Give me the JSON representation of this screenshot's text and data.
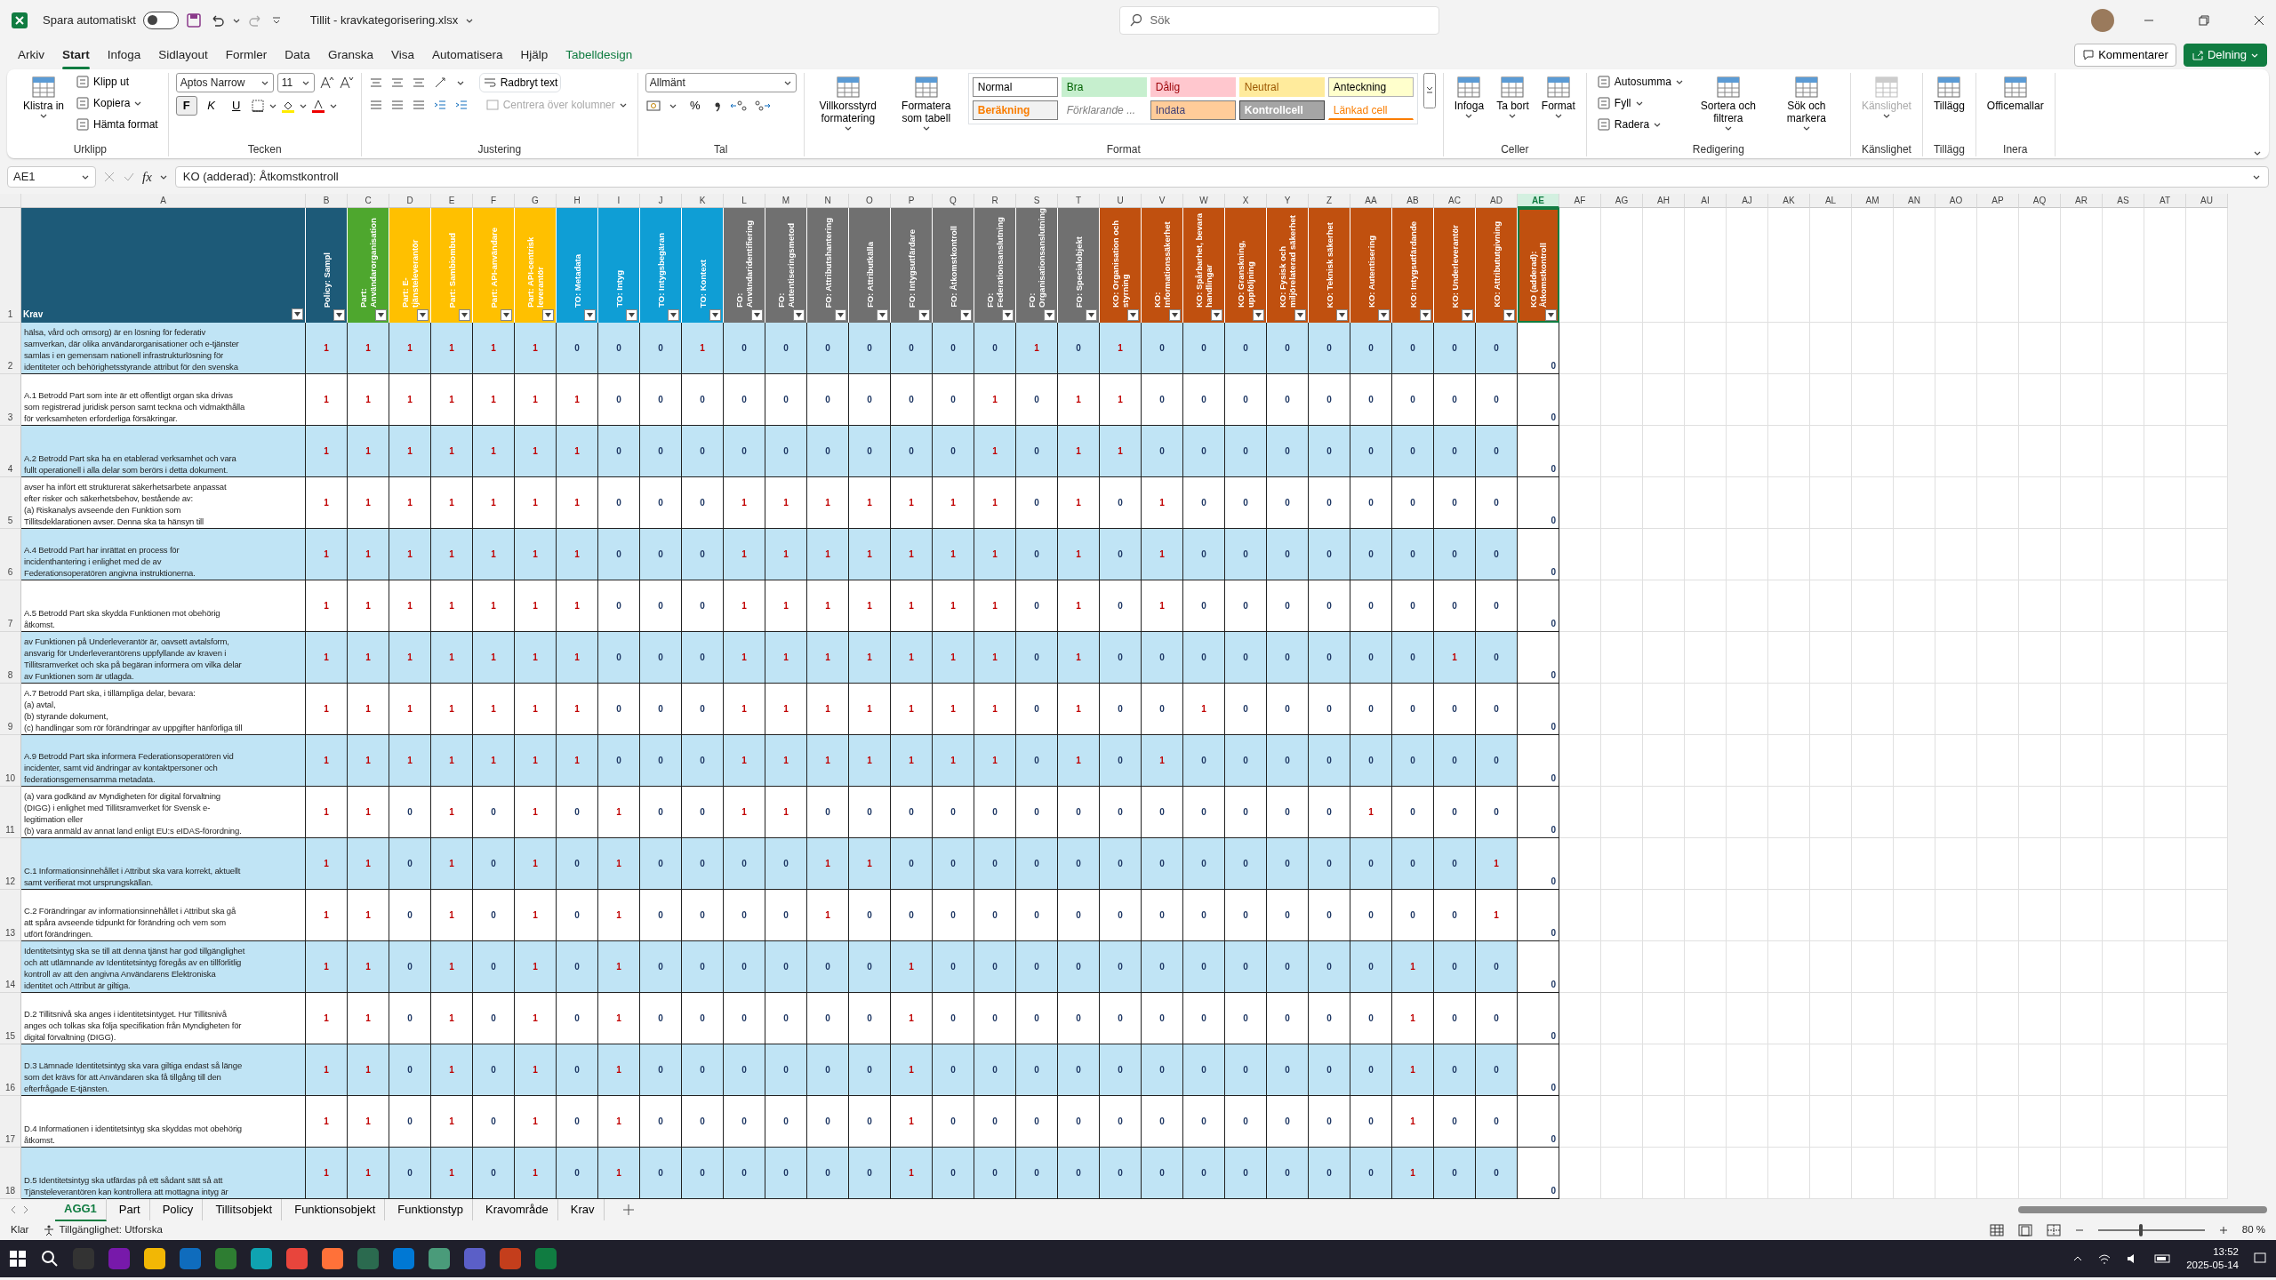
{
  "titlebar": {
    "autosave_label": "Spara automatiskt",
    "autosave_on": false,
    "file_title": "Tillit - kravkategorisering.xlsx",
    "search_placeholder": "Sök"
  },
  "menu_tabs": [
    {
      "label": "Arkiv",
      "selected": false,
      "kind": "standard"
    },
    {
      "label": "Start",
      "selected": true,
      "kind": "standard"
    },
    {
      "label": "Infoga",
      "selected": false,
      "kind": "standard"
    },
    {
      "label": "Sidlayout",
      "selected": false,
      "kind": "standard"
    },
    {
      "label": "Formler",
      "selected": false,
      "kind": "standard"
    },
    {
      "label": "Data",
      "selected": false,
      "kind": "standard"
    },
    {
      "label": "Granska",
      "selected": false,
      "kind": "standard"
    },
    {
      "label": "Visa",
      "selected": false,
      "kind": "standard"
    },
    {
      "label": "Automatisera",
      "selected": false,
      "kind": "standard"
    },
    {
      "label": "Hjälp",
      "selected": false,
      "kind": "standard"
    },
    {
      "label": "Tabelldesign",
      "selected": false,
      "kind": "contextual"
    }
  ],
  "actions": {
    "comments": "Kommentarer",
    "share": "Delning"
  },
  "ribbon": [
    {
      "kind": "clipboard",
      "group": "Urklipp",
      "large": [
        {
          "label": "Klistra in",
          "has_menu": true,
          "disabled": false
        }
      ],
      "small": [
        {
          "label": "Klipp ut",
          "has_menu": false
        },
        {
          "label": "Kopiera",
          "has_menu": true
        },
        {
          "label": "Hämta format",
          "has_menu": false
        }
      ]
    },
    {
      "kind": "font",
      "group": "Tecken",
      "font": "Aptos Narrow",
      "size": "11",
      "style_buttons": [
        {
          "label": "F",
          "selected": true
        },
        {
          "label": "K",
          "selected": false
        },
        {
          "label": "U",
          "selected": false
        }
      ]
    },
    {
      "kind": "align",
      "group": "Justering",
      "wrap": "Radbryt text",
      "merge": "Centrera över kolumner",
      "merge_disabled": true
    },
    {
      "kind": "number",
      "group": "Tal",
      "format": "Allmänt",
      "percent": "%"
    },
    {
      "kind": "styles",
      "group": "Format",
      "large": [
        {
          "label": "Villkorsstyrd formatering",
          "has_menu": true,
          "disabled": false
        },
        {
          "label": "Formatera som tabell",
          "has_menu": true,
          "disabled": false
        }
      ],
      "styles": [
        {
          "label": "Normal",
          "kind": "normal"
        },
        {
          "label": "Bra",
          "kind": "good"
        },
        {
          "label": "Dålig",
          "kind": "bad"
        },
        {
          "label": "Neutral",
          "kind": "neutral"
        },
        {
          "label": "Anteckning",
          "kind": "note"
        },
        {
          "label": "Beräkning",
          "kind": "calc"
        },
        {
          "label": "Förklarande ...",
          "kind": "explanatory"
        },
        {
          "label": "Indata",
          "kind": "input"
        },
        {
          "label": "Kontrollcell",
          "kind": "check"
        },
        {
          "label": "Länkad cell",
          "kind": "linked"
        }
      ]
    },
    {
      "kind": "buttons",
      "group": "Celler",
      "large": [
        {
          "label": "Infoga",
          "has_menu": true,
          "disabled": false
        },
        {
          "label": "Ta bort",
          "has_menu": true,
          "disabled": false
        },
        {
          "label": "Format",
          "has_menu": true,
          "disabled": false
        }
      ]
    },
    {
      "kind": "buttons",
      "group": "Redigering",
      "small": [
        {
          "label": "Autosumma",
          "has_menu": true
        },
        {
          "label": "Fyll",
          "has_menu": true
        },
        {
          "label": "Radera",
          "has_menu": true
        }
      ],
      "large": [
        {
          "label": "Sortera och filtrera",
          "has_menu": true,
          "disabled": false
        },
        {
          "label": "Sök och markera",
          "has_menu": true,
          "disabled": false
        }
      ]
    },
    {
      "kind": "buttons",
      "group": "Känslighet",
      "large": [
        {
          "label": "Känslighet",
          "has_menu": true,
          "disabled": true
        }
      ]
    },
    {
      "kind": "buttons",
      "group": "Tillägg",
      "large": [
        {
          "label": "Tillägg",
          "has_menu": false,
          "disabled": false
        }
      ]
    },
    {
      "kind": "buttons",
      "group": "Inera",
      "large": [
        {
          "label": "Officemallar",
          "has_menu": false,
          "disabled": false
        }
      ]
    }
  ],
  "formula_bar": {
    "name_box": "AE1",
    "fx": "fx",
    "formula": "KO (adderad): Åtkomstkontroll"
  },
  "column_letters": [
    {
      "label": "A",
      "selected": false
    },
    {
      "label": "B",
      "selected": false
    },
    {
      "label": "C",
      "selected": false
    },
    {
      "label": "D",
      "selected": false
    },
    {
      "label": "E",
      "selected": false
    },
    {
      "label": "F",
      "selected": false
    },
    {
      "label": "G",
      "selected": false
    },
    {
      "label": "H",
      "selected": false
    },
    {
      "label": "I",
      "selected": false
    },
    {
      "label": "J",
      "selected": false
    },
    {
      "label": "K",
      "selected": false
    },
    {
      "label": "L",
      "selected": false
    },
    {
      "label": "M",
      "selected": false
    },
    {
      "label": "N",
      "selected": false
    },
    {
      "label": "O",
      "selected": false
    },
    {
      "label": "P",
      "selected": false
    },
    {
      "label": "Q",
      "selected": false
    },
    {
      "label": "R",
      "selected": false
    },
    {
      "label": "S",
      "selected": false
    },
    {
      "label": "T",
      "selected": false
    },
    {
      "label": "U",
      "selected": false
    },
    {
      "label": "V",
      "selected": false
    },
    {
      "label": "W",
      "selected": false
    },
    {
      "label": "X",
      "selected": false
    },
    {
      "label": "Y",
      "selected": false
    },
    {
      "label": "Z",
      "selected": false
    },
    {
      "label": "AA",
      "selected": false
    },
    {
      "label": "AB",
      "selected": false
    },
    {
      "label": "AC",
      "selected": false
    },
    {
      "label": "AD",
      "selected": false
    },
    {
      "label": "AE",
      "selected": true
    },
    {
      "label": "AF",
      "selected": false
    },
    {
      "label": "AG",
      "selected": false
    },
    {
      "label": "AH",
      "selected": false
    },
    {
      "label": "AI",
      "selected": false
    },
    {
      "label": "AJ",
      "selected": false
    },
    {
      "label": "AK",
      "selected": false
    },
    {
      "label": "AL",
      "selected": false
    },
    {
      "label": "AM",
      "selected": false
    },
    {
      "label": "AN",
      "selected": false
    },
    {
      "label": "AO",
      "selected": false
    },
    {
      "label": "AP",
      "selected": false
    },
    {
      "label": "AQ",
      "selected": false
    },
    {
      "label": "AR",
      "selected": false
    },
    {
      "label": "AS",
      "selected": false
    },
    {
      "label": "AT",
      "selected": false
    },
    {
      "label": "AU",
      "selected": false
    }
  ],
  "header_row": {
    "row": "1",
    "first": "Krav",
    "labels": [
      {
        "text": "Policy: Sampl",
        "color": "#1d5a78"
      },
      {
        "text": "Part: Användarorganisation",
        "color": "#4ea72e"
      },
      {
        "text": "Part: E-tjänsteleverantör",
        "color": "#ffc000"
      },
      {
        "text": "Part: Sambiombud",
        "color": "#ffc000"
      },
      {
        "text": "Part: API-användare",
        "color": "#ffc000"
      },
      {
        "text": "Part: API-centrisk leverantör",
        "color": "#ffc000"
      },
      {
        "text": "TO: Metadata",
        "color": "#0f9ed5"
      },
      {
        "text": "TO: Intyg",
        "color": "#0f9ed5"
      },
      {
        "text": "TO: Intygsbegäran",
        "color": "#0f9ed5"
      },
      {
        "text": "TO: Kontext",
        "color": "#0f9ed5"
      },
      {
        "text": "FO: Användaridentifiering",
        "color": "#707070"
      },
      {
        "text": "FO: Autentiseringsmetod",
        "color": "#707070"
      },
      {
        "text": "FO: Attributshantering",
        "color": "#707070"
      },
      {
        "text": "FO: Attributkälla",
        "color": "#707070"
      },
      {
        "text": "FO: Intygsutfärdare",
        "color": "#707070"
      },
      {
        "text": "FO: Åtkomstkontroll",
        "color": "#707070"
      },
      {
        "text": "FO: Federationsanslutning",
        "color": "#707070"
      },
      {
        "text": "FO: Organisationsanslutning",
        "color": "#707070"
      },
      {
        "text": "FO: Specialobjekt",
        "color": "#707070"
      },
      {
        "text": "KO: Organisation och styrning",
        "color": "#c0500f"
      },
      {
        "text": "KO: Informationssäkerhet",
        "color": "#c0500f"
      },
      {
        "text": "KO: Spårbarhet, bevara handlingar",
        "color": "#c0500f"
      },
      {
        "text": "KO: Granskning, uppföljning",
        "color": "#c0500f"
      },
      {
        "text": "KO: Fysisk och miljörelaterad säkerhet",
        "color": "#c0500f"
      },
      {
        "text": "KO: Teknisk säkerhet",
        "color": "#c0500f"
      },
      {
        "text": "KO: Autentisering",
        "color": "#c0500f"
      },
      {
        "text": "KO: Intygsutfärdande",
        "color": "#c0500f"
      },
      {
        "text": "KO: Underleverantör",
        "color": "#c0500f"
      },
      {
        "text": "KO: Attribututgivning",
        "color": "#c0500f"
      },
      {
        "text": "KO (adderad): Åtkomstkontroll",
        "color": "#c0500f"
      }
    ]
  },
  "rows": [
    {
      "row": "2",
      "krav": [
        "hälsa, vård och omsorg) är en lösning för federativ",
        "samverkan, där olika användarorganisationer och e-tjänster",
        "samlas i en gemensam nationell infrastrukturlösning för",
        "identiteter och behörighetsstyrande attribut för den svenska"
      ],
      "values": [
        "1",
        "1",
        "1",
        "1",
        "1",
        "1",
        "0",
        "0",
        "0",
        "1",
        "0",
        "0",
        "0",
        "0",
        "0",
        "0",
        "0",
        "1",
        "0",
        "1",
        "0",
        "0",
        "0",
        "0",
        "0",
        "0",
        "0",
        "0",
        "0",
        "0"
      ]
    },
    {
      "row": "3",
      "krav": [
        "A.1 Betrodd Part som inte är ett offentligt organ ska drivas",
        "som registrerad juridisk person samt teckna och vidmakthålla",
        "för verksamheten erforderliga försäkringar."
      ],
      "values": [
        "1",
        "1",
        "1",
        "1",
        "1",
        "1",
        "1",
        "0",
        "0",
        "0",
        "0",
        "0",
        "0",
        "0",
        "0",
        "0",
        "1",
        "0",
        "1",
        "1",
        "0",
        "0",
        "0",
        "0",
        "0",
        "0",
        "0",
        "0",
        "0",
        "0"
      ]
    },
    {
      "row": "4",
      "krav": [
        "A.2 Betrodd Part ska ha en etablerad verksamhet och vara",
        "fullt operationell i alla delar som berörs i detta dokument."
      ],
      "values": [
        "1",
        "1",
        "1",
        "1",
        "1",
        "1",
        "1",
        "0",
        "0",
        "0",
        "0",
        "0",
        "0",
        "0",
        "0",
        "0",
        "1",
        "0",
        "1",
        "1",
        "0",
        "0",
        "0",
        "0",
        "0",
        "0",
        "0",
        "0",
        "0",
        "0"
      ]
    },
    {
      "row": "5",
      "krav": [
        "avser ha infört ett strukturerat säkerhetsarbete anpassat",
        "efter risker och säkerhetsbehov, bestående av:",
        "(a) Riskanalys avseende den Funktion som",
        "Tillitsdeklarationen avser. Denna ska ta hänsyn till"
      ],
      "values": [
        "1",
        "1",
        "1",
        "1",
        "1",
        "1",
        "1",
        "0",
        "0",
        "0",
        "1",
        "1",
        "1",
        "1",
        "1",
        "1",
        "1",
        "0",
        "1",
        "0",
        "1",
        "0",
        "0",
        "0",
        "0",
        "0",
        "0",
        "0",
        "0",
        "0"
      ]
    },
    {
      "row": "6",
      "krav": [
        "A.4 Betrodd Part har inrättat en process för",
        "incidenthantering i enlighet med de av",
        "Federationsoperatören angivna instruktionerna."
      ],
      "values": [
        "1",
        "1",
        "1",
        "1",
        "1",
        "1",
        "1",
        "0",
        "0",
        "0",
        "1",
        "1",
        "1",
        "1",
        "1",
        "1",
        "1",
        "0",
        "1",
        "0",
        "1",
        "0",
        "0",
        "0",
        "0",
        "0",
        "0",
        "0",
        "0",
        "0"
      ]
    },
    {
      "row": "7",
      "krav": [
        "A.5 Betrodd Part ska skydda Funktionen mot obehörig",
        "åtkomst."
      ],
      "values": [
        "1",
        "1",
        "1",
        "1",
        "1",
        "1",
        "1",
        "0",
        "0",
        "0",
        "1",
        "1",
        "1",
        "1",
        "1",
        "1",
        "1",
        "0",
        "1",
        "0",
        "1",
        "0",
        "0",
        "0",
        "0",
        "0",
        "0",
        "0",
        "0",
        "0"
      ]
    },
    {
      "row": "8",
      "krav": [
        "av Funktionen på Underleverantör är, oavsett avtalsform,",
        "ansvarig för Underleverantörens uppfyllande av kraven i",
        "Tillitsramverket och ska på begäran informera om vilka delar",
        "av Funktionen som är utlagda."
      ],
      "values": [
        "1",
        "1",
        "1",
        "1",
        "1",
        "1",
        "1",
        "0",
        "0",
        "0",
        "1",
        "1",
        "1",
        "1",
        "1",
        "1",
        "1",
        "0",
        "1",
        "0",
        "0",
        "0",
        "0",
        "0",
        "0",
        "0",
        "0",
        "1",
        "0",
        "0"
      ]
    },
    {
      "row": "9",
      "krav": [
        "A.7 Betrodd Part ska, i tillämpliga delar, bevara:",
        "(a) avtal,",
        "(b) styrande dokument,",
        "(c) handlingar som rör förändringar av uppgifter hänförliga till"
      ],
      "values": [
        "1",
        "1",
        "1",
        "1",
        "1",
        "1",
        "1",
        "0",
        "0",
        "0",
        "1",
        "1",
        "1",
        "1",
        "1",
        "1",
        "1",
        "0",
        "1",
        "0",
        "0",
        "1",
        "0",
        "0",
        "0",
        "0",
        "0",
        "0",
        "0",
        "0"
      ]
    },
    {
      "row": "10",
      "krav": [
        "A.9 Betrodd Part ska informera Federationsoperatören vid",
        "incidenter, samt vid ändringar av kontaktpersoner och",
        "federationsgemensamma metadata."
      ],
      "values": [
        "1",
        "1",
        "1",
        "1",
        "1",
        "1",
        "1",
        "0",
        "0",
        "0",
        "1",
        "1",
        "1",
        "1",
        "1",
        "1",
        "1",
        "0",
        "1",
        "0",
        "1",
        "0",
        "0",
        "0",
        "0",
        "0",
        "0",
        "0",
        "0",
        "0"
      ]
    },
    {
      "row": "11",
      "krav": [
        "(a) vara godkänd av Myndigheten för digital förvaltning",
        "(DIGG) i enlighet med Tillitsramverket för Svensk e-",
        "legitimation eller",
        "(b) vara anmäld av annat land enligt EU:s eIDAS-förordning."
      ],
      "values": [
        "1",
        "1",
        "0",
        "1",
        "0",
        "1",
        "0",
        "1",
        "0",
        "0",
        "1",
        "1",
        "0",
        "0",
        "0",
        "0",
        "0",
        "0",
        "0",
        "0",
        "0",
        "0",
        "0",
        "0",
        "0",
        "1",
        "0",
        "0",
        "0",
        "0"
      ]
    },
    {
      "row": "12",
      "krav": [
        "C.1 Informationsinnehållet i Attribut ska vara korrekt, aktuellt",
        "samt verifierat mot ursprungskällan."
      ],
      "values": [
        "1",
        "1",
        "0",
        "1",
        "0",
        "1",
        "0",
        "1",
        "0",
        "0",
        "0",
        "0",
        "1",
        "1",
        "0",
        "0",
        "0",
        "0",
        "0",
        "0",
        "0",
        "0",
        "0",
        "0",
        "0",
        "0",
        "0",
        "0",
        "1",
        "0"
      ]
    },
    {
      "row": "13",
      "krav": [
        "C.2 Förändringar av informationsinnehållet i Attribut ska gå",
        "att spåra avseende tidpunkt för förändring och vem som",
        "utfört förändringen."
      ],
      "values": [
        "1",
        "1",
        "0",
        "1",
        "0",
        "1",
        "0",
        "1",
        "0",
        "0",
        "0",
        "0",
        "1",
        "0",
        "0",
        "0",
        "0",
        "0",
        "0",
        "0",
        "0",
        "0",
        "0",
        "0",
        "0",
        "0",
        "0",
        "0",
        "1",
        "0"
      ]
    },
    {
      "row": "14",
      "krav": [
        "Identitetsintyg ska se till att denna tjänst har god tillgänglighet",
        "och att utlämnande av Identitetsintyg föregås av en tillförlitlig",
        "kontroll av att den angivna Användarens Elektroniska",
        "identitet och Attribut är giltiga."
      ],
      "values": [
        "1",
        "1",
        "0",
        "1",
        "0",
        "1",
        "0",
        "1",
        "0",
        "0",
        "0",
        "0",
        "0",
        "0",
        "1",
        "0",
        "0",
        "0",
        "0",
        "0",
        "0",
        "0",
        "0",
        "0",
        "0",
        "0",
        "1",
        "0",
        "0",
        "0"
      ]
    },
    {
      "row": "15",
      "krav": [
        "D.2 Tillitsnivå ska anges i identitetsintyget. Hur Tillitsnivå",
        "anges och tolkas ska följa specifikation från Myndigheten för",
        "digital förvaltning (DIGG)."
      ],
      "values": [
        "1",
        "1",
        "0",
        "1",
        "0",
        "1",
        "0",
        "1",
        "0",
        "0",
        "0",
        "0",
        "0",
        "0",
        "1",
        "0",
        "0",
        "0",
        "0",
        "0",
        "0",
        "0",
        "0",
        "0",
        "0",
        "0",
        "1",
        "0",
        "0",
        "0"
      ]
    },
    {
      "row": "16",
      "krav": [
        "D.3 Lämnade Identitetsintyg ska vara giltiga endast så länge",
        "som det krävs för att Användaren ska få tillgång till den",
        "efterfrågade E-tjänsten."
      ],
      "values": [
        "1",
        "1",
        "0",
        "1",
        "0",
        "1",
        "0",
        "1",
        "0",
        "0",
        "0",
        "0",
        "0",
        "0",
        "1",
        "0",
        "0",
        "0",
        "0",
        "0",
        "0",
        "0",
        "0",
        "0",
        "0",
        "0",
        "1",
        "0",
        "0",
        "0"
      ]
    },
    {
      "row": "17",
      "krav": [
        "D.4 Informationen i identitetsintyg ska skyddas mot obehörig",
        "åtkomst."
      ],
      "values": [
        "1",
        "1",
        "0",
        "1",
        "0",
        "1",
        "0",
        "1",
        "0",
        "0",
        "0",
        "0",
        "0",
        "0",
        "1",
        "0",
        "0",
        "0",
        "0",
        "0",
        "0",
        "0",
        "0",
        "0",
        "0",
        "0",
        "1",
        "0",
        "0",
        "0"
      ]
    },
    {
      "row": "18",
      "krav": [
        "D.5 Identitetsintyg ska utfärdas på ett sådant sätt så att",
        "Tjänsteleverantören kan kontrollera att mottagna intyg är"
      ],
      "values": [
        "1",
        "1",
        "0",
        "1",
        "0",
        "1",
        "0",
        "1",
        "0",
        "0",
        "0",
        "0",
        "0",
        "0",
        "1",
        "0",
        "0",
        "0",
        "0",
        "0",
        "0",
        "0",
        "0",
        "0",
        "0",
        "0",
        "1",
        "0",
        "0",
        "0"
      ]
    }
  ],
  "sheet_tabs": [
    {
      "label": "AGG1",
      "selected": true
    },
    {
      "label": "Part",
      "selected": false
    },
    {
      "label": "Policy",
      "selected": false
    },
    {
      "label": "Tillitsobjekt",
      "selected": false
    },
    {
      "label": "Funktionsobjekt",
      "selected": false
    },
    {
      "label": "Funktionstyp",
      "selected": false
    },
    {
      "label": "Kravområde",
      "selected": false
    },
    {
      "label": "Krav",
      "selected": false
    }
  ],
  "status_bar": {
    "ready": "Klar",
    "accessibility": "Tillgänglighet: Utforska",
    "zoom": "80 %",
    "zoom_slider": {
      "level": 0.4
    }
  },
  "taskbar": {
    "time": "13:52",
    "date": "2025-05-14"
  }
}
